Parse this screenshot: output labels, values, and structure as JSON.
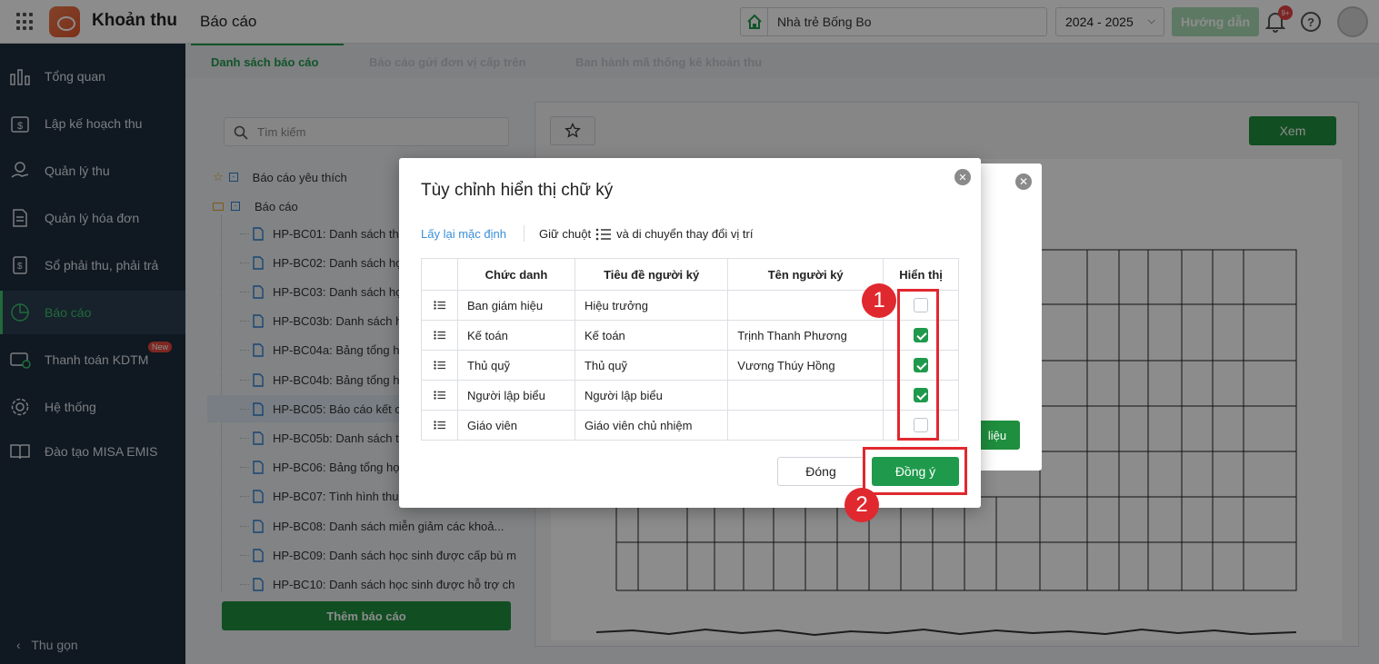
{
  "app": {
    "name": "Khoản thu",
    "page": "Báo cáo"
  },
  "header": {
    "school": "Nhà trẻ Bống Bo",
    "year": "2024 - 2025",
    "guide": "Hướng dẫn",
    "notif_badge": "9+"
  },
  "sidebar": {
    "items": [
      {
        "label": "Tổng quan",
        "icon": "chart-bars-icon"
      },
      {
        "label": "Lập kế hoạch thu",
        "icon": "calendar-dollar-icon"
      },
      {
        "label": "Quản lý thu",
        "icon": "hand-coin-icon"
      },
      {
        "label": "Quản lý hóa đơn",
        "icon": "invoice-icon"
      },
      {
        "label": "Sổ phải thu, phải trả",
        "icon": "ledger-icon"
      },
      {
        "label": "Báo cáo",
        "icon": "pie-chart-icon"
      },
      {
        "label": "Thanh toán KDTM",
        "icon": "payment-icon",
        "badge": "New"
      },
      {
        "label": "Hệ thống",
        "icon": "gear-icon"
      },
      {
        "label": "Đào tạo MISA EMIS",
        "icon": "book-icon"
      }
    ],
    "collapse": "Thu gọn"
  },
  "tabs": [
    "Danh sách báo cáo",
    "Báo cáo gửi đơn vị cấp trên",
    "Ban hành mã thống kê khoản thu"
  ],
  "left": {
    "search_placeholder": "Tìm kiếm",
    "favorites": "Báo cáo yêu thích",
    "group": "Báo cáo",
    "reports": [
      "HP-BC01: Danh sách th",
      "HP-BC02: Danh sách họ",
      "HP-BC03: Danh sách họ",
      "HP-BC03b: Danh sách h",
      "HP-BC04a: Bảng tổng h",
      "HP-BC04b: Bảng tổng h",
      "HP-BC05: Báo cáo kết c",
      "HP-BC05b: Danh sách t",
      "HP-BC06: Bảng tổng họ",
      "HP-BC07: Tình hình thu",
      "HP-BC08: Danh sách miễn giảm các khoả...",
      "HP-BC09: Danh sách học sinh được cấp bù m",
      "HP-BC10: Danh sách học sinh được hỗ trợ ch"
    ],
    "add_button": "Thêm báo cáo"
  },
  "right": {
    "view_button": "Xem",
    "bg_button": "liệu"
  },
  "dialog": {
    "title": "Tùy chỉnh hiển thị chữ ký",
    "reset": "Lấy lại mặc định",
    "hint_pre": "Giữ chuột",
    "hint_post": "và di chuyển thay đổi vị trí",
    "columns": [
      "Chức danh",
      "Tiêu đề người ký",
      "Tên người ký",
      "Hiển thị"
    ],
    "rows": [
      {
        "role": "Ban giám hiệu",
        "title": "Hiệu trưởng",
        "name": "",
        "show": false
      },
      {
        "role": "Kế toán",
        "title": "Kế toán",
        "name": "Trịnh Thanh Phương",
        "show": true
      },
      {
        "role": "Thủ quỹ",
        "title": "Thủ quỹ",
        "name": "Vương Thúy Hồng",
        "show": true
      },
      {
        "role": "Người lập biểu",
        "title": "Người lập biểu",
        "name": "",
        "show": true
      },
      {
        "role": "Giáo viên",
        "title": "Giáo viên chủ nhiệm",
        "name": "",
        "show": false
      }
    ],
    "close": "Đóng",
    "ok": "Đồng ý"
  },
  "markers": [
    "1",
    "2"
  ],
  "colors": {
    "primary": "#1f9a4c",
    "sidebar": "#1e2d3d",
    "highlight": "#e0282f"
  }
}
